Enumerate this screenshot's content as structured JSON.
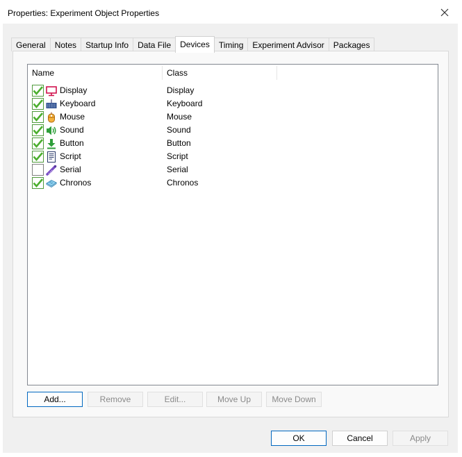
{
  "window": {
    "title": "Properties: Experiment Object Properties",
    "close_glyph": "✕"
  },
  "tabs": [
    {
      "label": "General"
    },
    {
      "label": "Notes"
    },
    {
      "label": "Startup Info"
    },
    {
      "label": "Data File"
    },
    {
      "label": "Devices",
      "active": true
    },
    {
      "label": "Timing"
    },
    {
      "label": "Experiment Advisor"
    },
    {
      "label": "Packages"
    }
  ],
  "list": {
    "columns": [
      "Name",
      "Class"
    ],
    "rows": [
      {
        "name": "Display",
        "class": "Display",
        "checked": true,
        "icon": "monitor-icon"
      },
      {
        "name": "Keyboard",
        "class": "Keyboard",
        "checked": true,
        "icon": "keyboard-icon"
      },
      {
        "name": "Mouse",
        "class": "Mouse",
        "checked": true,
        "icon": "mouse-icon"
      },
      {
        "name": "Sound",
        "class": "Sound",
        "checked": true,
        "icon": "speaker-icon"
      },
      {
        "name": "Button",
        "class": "Button",
        "checked": true,
        "icon": "down-arrow-icon"
      },
      {
        "name": "Script",
        "class": "Script",
        "checked": true,
        "icon": "script-icon"
      },
      {
        "name": "Serial",
        "class": "Serial",
        "checked": false,
        "icon": "serial-cable-icon"
      },
      {
        "name": "Chronos",
        "class": "Chronos",
        "checked": true,
        "icon": "chronos-icon"
      }
    ]
  },
  "list_buttons": {
    "add": "Add...",
    "remove": "Remove",
    "edit": "Edit...",
    "move_up": "Move Up",
    "move_down": "Move Down"
  },
  "dialog_buttons": {
    "ok": "OK",
    "cancel": "Cancel",
    "apply": "Apply"
  },
  "colors": {
    "check_green": "#4caf2f",
    "accent_blue": "#0067c0"
  }
}
